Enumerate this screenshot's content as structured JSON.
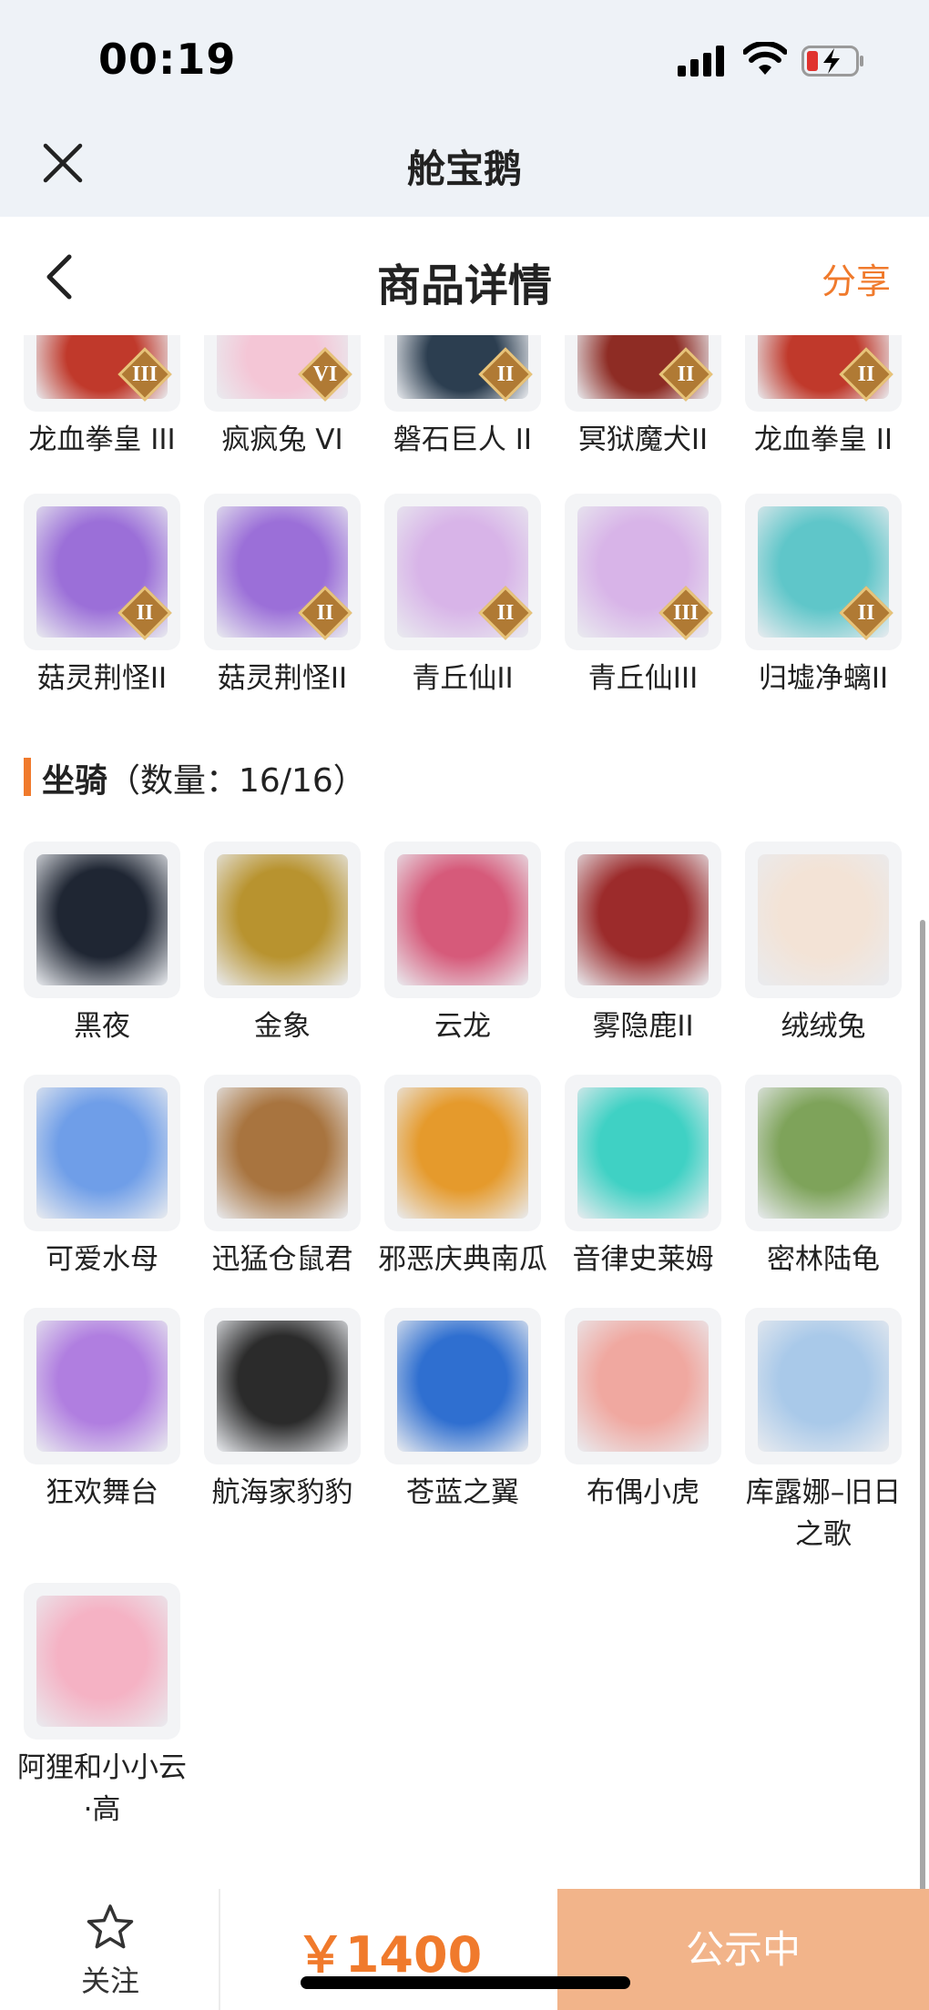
{
  "status_bar": {
    "time": "00:19"
  },
  "app_bar": {
    "title": "舱宝鹅"
  },
  "header": {
    "title": "商品详情",
    "share": "分享"
  },
  "colors": {
    "accent": "#f07a2c",
    "status_button": "#f2b48a",
    "top_background": "#eef2f7"
  },
  "top_row": [
    {
      "name": "龙血拳皇 III",
      "rank": "III",
      "color": "#c0392b"
    },
    {
      "name": "疯疯兔 VI",
      "rank": "VI",
      "color": "#f4c6d6"
    },
    {
      "name": "磐石巨人 II",
      "rank": "II",
      "color": "#2c3e50"
    },
    {
      "name": "冥狱魔犬II",
      "rank": "II",
      "color": "#8e2c24"
    },
    {
      "name": "龙血拳皇 II",
      "rank": "II",
      "color": "#c0392b"
    }
  ],
  "second_row": [
    {
      "name": "菇灵荆怪II",
      "rank": "II",
      "color": "#9b6fd8"
    },
    {
      "name": "菇灵荆怪II",
      "rank": "II",
      "color": "#9b6fd8"
    },
    {
      "name": "青丘仙II",
      "rank": "II",
      "color": "#d8b4e8"
    },
    {
      "name": "青丘仙III",
      "rank": "III",
      "color": "#d8b4e8"
    },
    {
      "name": "归墟净螭II",
      "rank": "II",
      "color": "#5fc6c9"
    }
  ],
  "mounts_section": {
    "title": "坐骑",
    "count_text": "（数量：16/16）"
  },
  "mounts": [
    {
      "name": "黑夜",
      "color": "#1f2633"
    },
    {
      "name": "金象",
      "color": "#b8932f"
    },
    {
      "name": "云龙",
      "color": "#d65a7a"
    },
    {
      "name": "雾隐鹿II",
      "color": "#9c2b2b"
    },
    {
      "name": "绒绒兔",
      "color": "#f3e3d6"
    },
    {
      "name": "可爱水母",
      "color": "#6f9ee8"
    },
    {
      "name": "迅猛仓鼠君",
      "color": "#a8743f"
    },
    {
      "name": "邪恶庆典南瓜",
      "color": "#e59a2c"
    },
    {
      "name": "音律史莱姆",
      "color": "#3fd1c4"
    },
    {
      "name": "密林陆龟",
      "color": "#7ea35a"
    },
    {
      "name": "狂欢舞台",
      "color": "#b07ee0"
    },
    {
      "name": "航海家豹豹",
      "color": "#2b2b2b"
    },
    {
      "name": "苍蓝之翼",
      "color": "#2f6fd0"
    },
    {
      "name": "布偶小虎",
      "color": "#f0a8a0"
    },
    {
      "name": "库露娜–旧日之歌",
      "color": "#a9c9e9"
    },
    {
      "name": "阿狸和小小云·高",
      "color": "#f5b2c4"
    }
  ],
  "bottom_bar": {
    "follow_label": "关注",
    "price": "￥1400",
    "status_button": "公示中"
  }
}
